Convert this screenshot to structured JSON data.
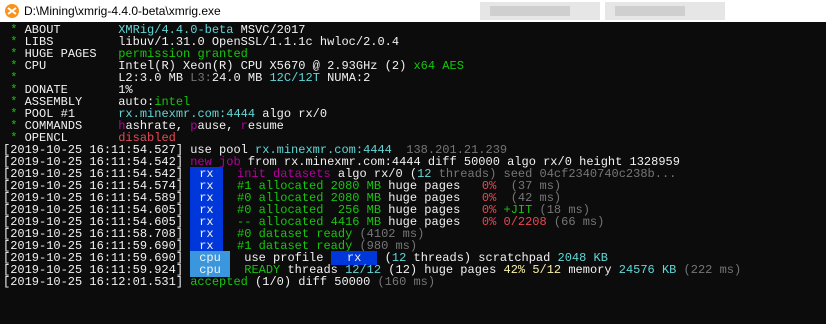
{
  "window": {
    "title": "D:\\Mining\\xmrig-4.4.0-beta\\xmrig.exe",
    "icon": "xmrig-icon"
  },
  "summary": [
    {
      "label": "ABOUT",
      "value": [
        {
          "t": "XMRig/4.4.0-beta",
          "c": "C"
        },
        {
          "t": " MSVC/2017",
          "c": "w"
        }
      ]
    },
    {
      "label": "LIBS",
      "value": [
        {
          "t": "libuv/1.31.0 OpenSSL/1.1.1c hwloc/2.0.4",
          "c": "w"
        }
      ]
    },
    {
      "label": "HUGE PAGES",
      "value": [
        {
          "t": "permission granted",
          "c": "G"
        }
      ]
    },
    {
      "label": "CPU",
      "value": [
        {
          "t": "Intel(R) Xeon(R) CPU X5670 @ 2.93GHz (2) ",
          "c": "w"
        },
        {
          "t": "x64 AES",
          "c": "G"
        }
      ]
    },
    {
      "label": "",
      "value": [
        {
          "t": "L2:",
          "c": "w"
        },
        {
          "t": "3.0 MB ",
          "c": "w"
        },
        {
          "t": "L3:",
          "c": "gr"
        },
        {
          "t": "24.0 MB ",
          "c": "w"
        },
        {
          "t": "12C/12T ",
          "c": "C"
        },
        {
          "t": "NUMA:2",
          "c": "w"
        }
      ]
    },
    {
      "label": "DONATE",
      "value": [
        {
          "t": "1%",
          "c": "w"
        }
      ]
    },
    {
      "label": "ASSEMBLY",
      "value": [
        {
          "t": "auto:",
          "c": "w"
        },
        {
          "t": "intel",
          "c": "G"
        }
      ]
    },
    {
      "label": "POOL #1",
      "value": [
        {
          "t": "rx.minexmr.com:4444",
          "c": "C"
        },
        {
          "t": " algo rx/0",
          "c": "w"
        }
      ]
    },
    {
      "label": "COMMANDS",
      "value": [
        {
          "t": "h",
          "c": "m"
        },
        {
          "t": "ashrate, ",
          "c": "w"
        },
        {
          "t": "p",
          "c": "m"
        },
        {
          "t": "ause, ",
          "c": "w"
        },
        {
          "t": "r",
          "c": "m"
        },
        {
          "t": "esume",
          "c": "w"
        }
      ]
    },
    {
      "label": "OPENCL",
      "value": [
        {
          "t": "disabled",
          "c": "R"
        }
      ]
    }
  ],
  "log": [
    {
      "ts": "2019-10-25 16:11:54.527",
      "parts": [
        {
          "t": "use pool ",
          "c": "w"
        },
        {
          "t": "rx.minexmr.com:4444 ",
          "c": "C"
        },
        {
          "t": " 138.201.21.239",
          "c": "gr"
        }
      ]
    },
    {
      "ts": "2019-10-25 16:11:54.542",
      "parts": [
        {
          "t": "new job",
          "c": "m"
        },
        {
          "t": " from rx.minexmr.com:4444 diff 50000 algo rx/0 height 1328959",
          "c": "w"
        }
      ]
    },
    {
      "ts": "2019-10-25 16:11:54.542",
      "tag": "rx",
      "parts": [
        {
          "t": "init datasets",
          "c": "m"
        },
        {
          "t": " algo rx/0 (",
          "c": "w"
        },
        {
          "t": "12",
          "c": "C"
        },
        {
          "t": " threads) seed 04cf2340740c238b...",
          "c": "gr"
        }
      ]
    },
    {
      "ts": "2019-10-25 16:11:54.574",
      "tag": "rx",
      "parts": [
        {
          "t": "#1 allocated 2080 MB",
          "c": "G"
        },
        {
          "t": " huge pages ",
          "c": "w"
        },
        {
          "t": "  0%",
          "c": "R"
        },
        {
          "t": "  (37 ms)",
          "c": "gr"
        }
      ]
    },
    {
      "ts": "2019-10-25 16:11:54.589",
      "tag": "rx",
      "parts": [
        {
          "t": "#0 allocated 2080 MB",
          "c": "G"
        },
        {
          "t": " huge pages ",
          "c": "w"
        },
        {
          "t": "  0%",
          "c": "R"
        },
        {
          "t": "  (42 ms)",
          "c": "gr"
        }
      ]
    },
    {
      "ts": "2019-10-25 16:11:54.605",
      "tag": "rx",
      "parts": [
        {
          "t": "#0 allocated  256 MB",
          "c": "G"
        },
        {
          "t": " huge pages ",
          "c": "w"
        },
        {
          "t": "  0%",
          "c": "R"
        },
        {
          "t": " +JIT",
          "c": "G"
        },
        {
          "t": " (18 ms)",
          "c": "gr"
        }
      ]
    },
    {
      "ts": "2019-10-25 16:11:54.605",
      "tag": "rx",
      "parts": [
        {
          "t": "-- allocated 4416 MB",
          "c": "G"
        },
        {
          "t": " huge pages ",
          "c": "w"
        },
        {
          "t": "  0% 0/2208",
          "c": "R"
        },
        {
          "t": " (66 ms)",
          "c": "gr"
        }
      ]
    },
    {
      "ts": "2019-10-25 16:11:58.708",
      "tag": "rx",
      "parts": [
        {
          "t": "#0 dataset ready",
          "c": "G"
        },
        {
          "t": " (4102 ms)",
          "c": "gr"
        }
      ]
    },
    {
      "ts": "2019-10-25 16:11:59.690",
      "tag": "rx",
      "parts": [
        {
          "t": "#1 dataset ready",
          "c": "G"
        },
        {
          "t": " (980 ms)",
          "c": "gr"
        }
      ]
    },
    {
      "ts": "2019-10-25 16:11:59.690",
      "tag": "cpu",
      "parts": [
        {
          "t": "use profile ",
          "c": "w"
        },
        {
          "t": " rx ",
          "c": "tagrx"
        },
        {
          "t": " (",
          "c": "w"
        },
        {
          "t": "12",
          "c": "C"
        },
        {
          "t": " threads) scratchpad ",
          "c": "w"
        },
        {
          "t": "2048 KB",
          "c": "C"
        }
      ]
    },
    {
      "ts": "2019-10-25 16:11:59.924",
      "tag": "cpu",
      "parts": [
        {
          "t": "READY",
          "c": "G"
        },
        {
          "t": " threads ",
          "c": "w"
        },
        {
          "t": "12/12",
          "c": "C"
        },
        {
          "t": " (12) huge pages ",
          "c": "w"
        },
        {
          "t": "42%",
          "c": "Y"
        },
        {
          "t": " ",
          "c": "w"
        },
        {
          "t": "5/12",
          "c": "Y"
        },
        {
          "t": " memory ",
          "c": "w"
        },
        {
          "t": "24576 KB",
          "c": "C"
        },
        {
          "t": " (222 ms)",
          "c": "gr"
        }
      ]
    },
    {
      "ts": "2019-10-25 16:12:01.531",
      "parts": [
        {
          "t": "accepted",
          "c": "G"
        },
        {
          "t": " (1/0) diff 50000 ",
          "c": "w"
        },
        {
          "t": "(160 ms)",
          "c": "gr"
        }
      ]
    }
  ]
}
